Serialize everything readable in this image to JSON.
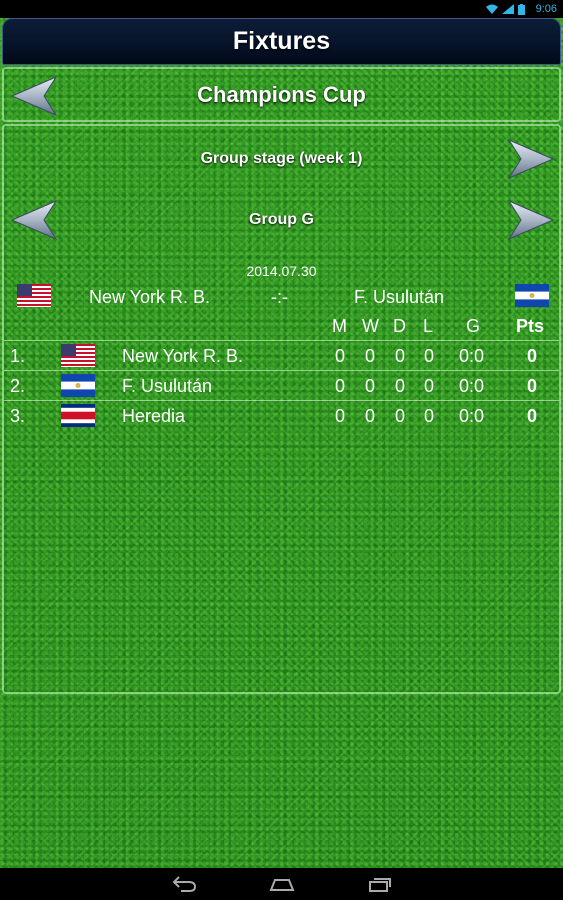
{
  "status": {
    "time": "9:06"
  },
  "header": {
    "title": "Fixtures"
  },
  "competition": {
    "name": "Champions Cup"
  },
  "stage": {
    "label": "Group stage (week 1)"
  },
  "group": {
    "label": "Group G"
  },
  "match": {
    "date": "2014.07.30",
    "home": "New York R. B.",
    "score": "-:-",
    "away": "F. Usulután",
    "home_flag": "us-flag",
    "away_flag": "el-salvador-flag"
  },
  "table": {
    "headers": {
      "m": "M",
      "w": "W",
      "d": "D",
      "l": "L",
      "g": "G",
      "pts": "Pts"
    },
    "rows": [
      {
        "pos": "1.",
        "flag": "us-flag",
        "team": "New York R. B.",
        "m": "0",
        "w": "0",
        "d": "0",
        "l": "0",
        "g": "0:0",
        "pts": "0"
      },
      {
        "pos": "2.",
        "flag": "el-salvador-flag",
        "team": "F. Usulután",
        "m": "0",
        "w": "0",
        "d": "0",
        "l": "0",
        "g": "0:0",
        "pts": "0"
      },
      {
        "pos": "3.",
        "flag": "costa-rica-flag",
        "team": "Heredia",
        "m": "0",
        "w": "0",
        "d": "0",
        "l": "0",
        "g": "0:0",
        "pts": "0"
      }
    ]
  },
  "colors": {
    "header_bg": "#07142a",
    "grass": "#2f9a22",
    "accent": "#33b5e5"
  }
}
